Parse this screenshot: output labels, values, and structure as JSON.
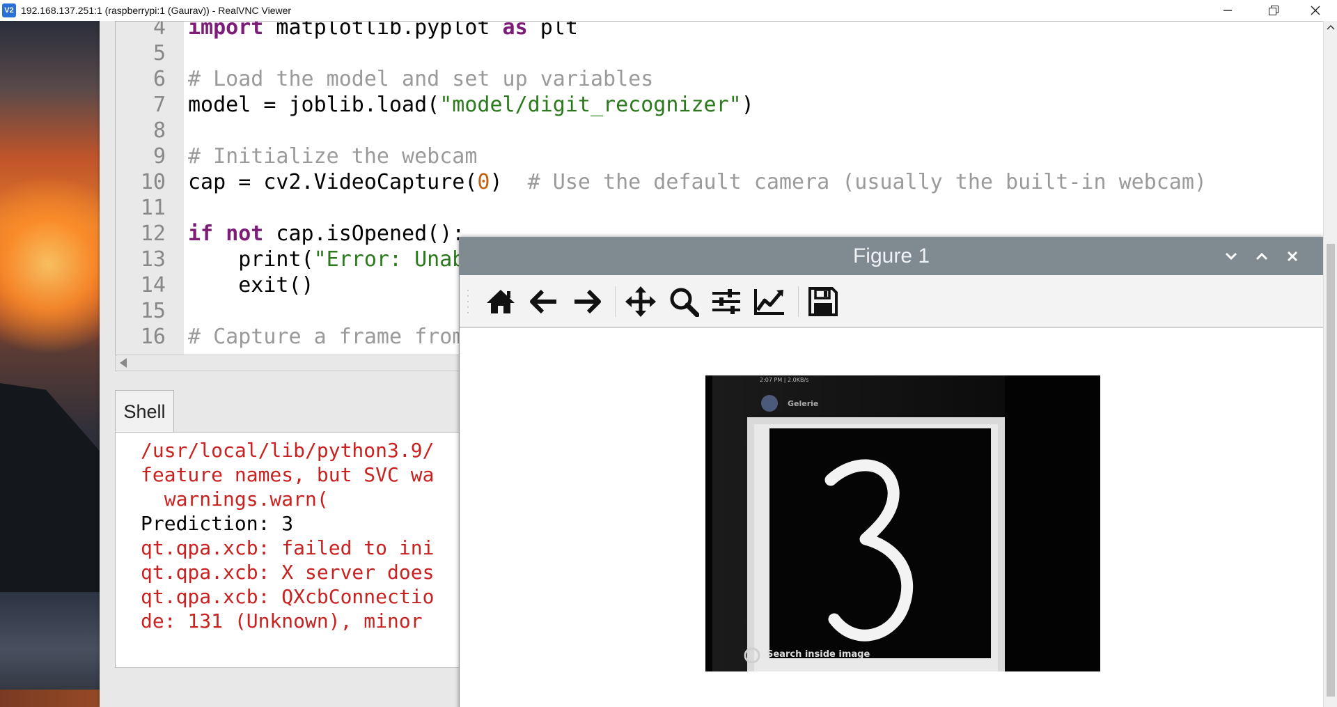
{
  "vnc": {
    "title": "192.168.137.251:1 (raspberrypi:1 (Gaurav)) - RealVNC Viewer",
    "app_icon_text": "V2"
  },
  "editor": {
    "lines": [
      {
        "n": "4",
        "parts": [
          {
            "t": "import",
            "c": "kw"
          },
          {
            "t": " matplotlib.pyplot ",
            "c": ""
          },
          {
            "t": "as",
            "c": "kw"
          },
          {
            "t": " plt",
            "c": ""
          }
        ]
      },
      {
        "n": "5",
        "parts": []
      },
      {
        "n": "6",
        "parts": [
          {
            "t": "# Load the model and set up variables",
            "c": "cm"
          }
        ]
      },
      {
        "n": "7",
        "parts": [
          {
            "t": "model = joblib.load(",
            "c": ""
          },
          {
            "t": "\"model/digit_recognizer\"",
            "c": "str"
          },
          {
            "t": ")",
            "c": ""
          }
        ]
      },
      {
        "n": "8",
        "parts": []
      },
      {
        "n": "9",
        "parts": [
          {
            "t": "# Initialize the webcam",
            "c": "cm"
          }
        ]
      },
      {
        "n": "10",
        "parts": [
          {
            "t": "cap = cv2.VideoCapture(",
            "c": ""
          },
          {
            "t": "0",
            "c": "num"
          },
          {
            "t": ")  ",
            "c": ""
          },
          {
            "t": "# Use the default camera (usually the built-in webcam)",
            "c": "cm"
          }
        ]
      },
      {
        "n": "11",
        "parts": []
      },
      {
        "n": "12",
        "parts": [
          {
            "t": "if",
            "c": "kw"
          },
          {
            "t": " ",
            "c": ""
          },
          {
            "t": "not",
            "c": "kw"
          },
          {
            "t": " cap.isOpened():",
            "c": ""
          }
        ]
      },
      {
        "n": "13",
        "parts": [
          {
            "t": "    print(",
            "c": ""
          },
          {
            "t": "\"Error: Unable to open webcam\"",
            "c": "str"
          },
          {
            "t": ")",
            "c": ""
          }
        ]
      },
      {
        "n": "14",
        "parts": [
          {
            "t": "    exit()",
            "c": ""
          }
        ]
      },
      {
        "n": "15",
        "parts": []
      },
      {
        "n": "16",
        "parts": [
          {
            "t": "# Capture a frame from the webcam",
            "c": "cm"
          }
        ]
      }
    ]
  },
  "shell": {
    "tab_label": "Shell",
    "lines": [
      {
        "t": "/usr/local/lib/python3.9/",
        "c": "red"
      },
      {
        "t": "feature names, but SVC wa",
        "c": "red"
      },
      {
        "t": "  warnings.warn(",
        "c": "red"
      },
      {
        "t": "Prediction: 3",
        "c": ""
      },
      {
        "t": "qt.qpa.xcb: failed to ini",
        "c": "red"
      },
      {
        "t": "qt.qpa.xcb: X server does",
        "c": "red"
      },
      {
        "t": "qt.qpa.xcb: QXcbConnectio",
        "c": "red"
      },
      {
        "t": "de: 131 (Unknown), minor ",
        "c": "red"
      }
    ]
  },
  "figure": {
    "title": "Figure 1",
    "tools": [
      "home-icon",
      "back-arrow-icon",
      "forward-arrow-icon",
      "pan-icon",
      "zoom-icon",
      "configure-subplots-icon",
      "edit-axes-icon",
      "save-icon"
    ],
    "image": {
      "digit": "3",
      "status_text": "2:07 PM | 2.0KB/s",
      "app_label": "Gelerie",
      "lens_label": "Search inside image"
    }
  }
}
